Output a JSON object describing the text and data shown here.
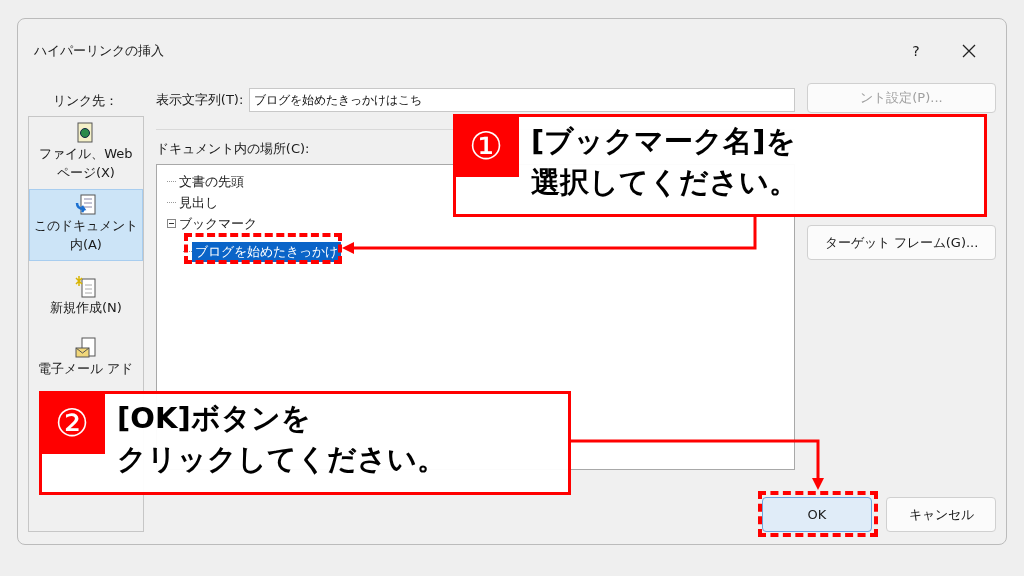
{
  "window": {
    "title": "ハイパーリンクの挿入",
    "help_button": "?"
  },
  "sidebar": {
    "label": "リンク先：",
    "items": [
      {
        "kind": "file-web",
        "lines": [
          "ファイル、Web",
          "ページ(X)"
        ],
        "selected": false
      },
      {
        "kind": "document",
        "lines": [
          "このドキュメント",
          "内(A)"
        ],
        "selected": true
      },
      {
        "kind": "new",
        "lines": [
          "新規作成(N)"
        ],
        "selected": false
      },
      {
        "kind": "email",
        "lines": [
          "電子メール アド"
        ],
        "selected": false
      }
    ]
  },
  "display_text": {
    "label": "表示文字列(T):",
    "value": "ブログを始めたきっかけはこち"
  },
  "tree": {
    "label": "ドキュメント内の場所(C):",
    "items": [
      {
        "label": "文書の先頭",
        "selected": false
      },
      {
        "label": "見出し",
        "selected": false
      },
      {
        "label": "ブックマーク",
        "selected": false,
        "expanded": true,
        "children": [
          {
            "label": "ブログを始めたきっかけ",
            "selected": true
          }
        ]
      }
    ]
  },
  "side_buttons": [
    "ント設定(P)...",
    "ターゲット フレーム(G)..."
  ],
  "buttons": [
    {
      "label": "OK",
      "default": true
    },
    {
      "label": "キャンセル",
      "default": false
    }
  ],
  "callouts": [
    {
      "number": "①",
      "lines": [
        "[ブックマーク名]を",
        "選択してください。"
      ]
    },
    {
      "number": "②",
      "lines": [
        "[OK]ボタンを",
        "クリックしてください。"
      ]
    }
  ]
}
